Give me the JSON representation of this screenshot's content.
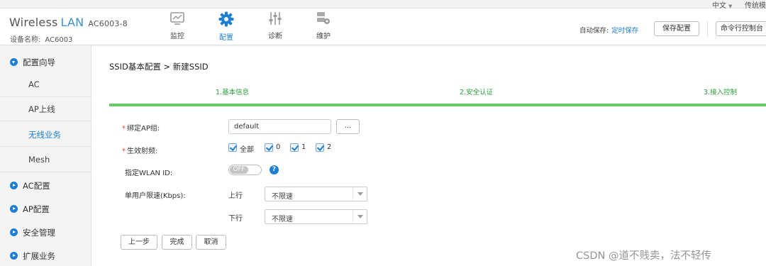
{
  "lang": {
    "current": "中文",
    "other": "传统模"
  },
  "brand": {
    "name": "Wireless",
    "lan": "LAN",
    "model": "AC6003-8"
  },
  "device": {
    "label": "设备名称:",
    "value": "AC6003"
  },
  "nav": [
    {
      "label": "监控",
      "icon": "monitor-icon"
    },
    {
      "label": "配置",
      "icon": "gear-icon"
    },
    {
      "label": "诊断",
      "icon": "sliders-icon"
    },
    {
      "label": "维护",
      "icon": "maintenance-icon"
    }
  ],
  "header": {
    "autosave_label": "自动保存:",
    "autosave_link": "定时保存",
    "save_button": "保存配置",
    "cli_button": "命令行控制台"
  },
  "sidebar": {
    "groups": [
      {
        "label": "配置向导"
      },
      {
        "label": "AC配置"
      },
      {
        "label": "AP配置"
      },
      {
        "label": "安全管理"
      },
      {
        "label": "扩展业务"
      }
    ],
    "items": [
      {
        "label": "AC"
      },
      {
        "label": "AP上线"
      },
      {
        "label": "无线业务"
      },
      {
        "label": "Mesh"
      }
    ]
  },
  "breadcrumb": "SSID基本配置 > 新建SSID",
  "steps": [
    "1.基本信息",
    "2.安全认证",
    "3.接入控制"
  ],
  "form": {
    "ap_group_label": "绑定AP组:",
    "ap_group_value": "default",
    "browse_button": "...",
    "freq_label": "生效射频:",
    "freq_options": [
      "全部",
      "0",
      "1",
      "2"
    ],
    "wlan_id_label": "指定WLAN ID:",
    "wlan_id_toggle": "OFF",
    "help_mark": "?",
    "rate_label": "单用户限速(Kbps):",
    "up_label": "上行",
    "up_value": "不限速",
    "down_label": "下行",
    "down_value": "不限速"
  },
  "buttons": {
    "prev": "上一步",
    "finish": "完成",
    "cancel": "取消"
  },
  "watermark": "CSDN @道不贱卖，法不轻传",
  "colors": {
    "accent": "#1c7fd4",
    "progress": "#6cc76a",
    "step_text": "#2a9d3a",
    "required": "#e04a3a"
  }
}
